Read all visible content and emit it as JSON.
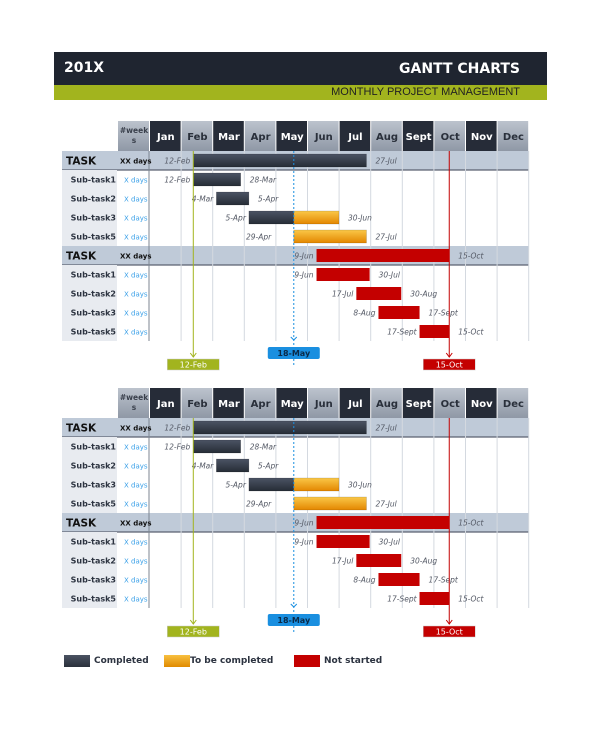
{
  "header": {
    "year": "201X",
    "title": "GANTT CHARTS",
    "subtitle": "MONTHLY PROJECT MANAGEMENT"
  },
  "colors": {
    "banner": "#1f2530",
    "accent_green": "#a2b41e",
    "completed": "#353c4a",
    "to_be_completed": "#f0a010",
    "not_started": "#c40000",
    "today_marker": "#1a8fe0",
    "task_row": "#bfcad8",
    "month_dark": "#262c38",
    "month_light": "#a9b1bd"
  },
  "legend": [
    {
      "label": "Completed",
      "status": "completed"
    },
    {
      "label": "To be completed",
      "status": "to_be_completed"
    },
    {
      "label": "Not started",
      "status": "not_started"
    }
  ],
  "chart_data": [
    {
      "type": "gantt",
      "weeks_header": "#week s",
      "months": [
        "Jan",
        "Feb",
        "Mar",
        "Apr",
        "May",
        "Jun",
        "Jul",
        "Aug",
        "Sept",
        "Oct",
        "Nov",
        "Dec"
      ],
      "markers": [
        {
          "label": "12-Feb",
          "date": 1.37,
          "kind": "start",
          "color": "#a2b41e"
        },
        {
          "label": "18-May",
          "date": 4.55,
          "kind": "today",
          "color": "#1a8fe0"
        },
        {
          "label": "15-Oct",
          "date": 9.47,
          "kind": "end",
          "color": "#c40000"
        }
      ],
      "groups": [
        {
          "task": {
            "name": "TASK",
            "duration": "XX days",
            "start_label": "12-Feb",
            "end_label": "27-Jul",
            "start": 1.37,
            "end": 6.85,
            "segments": [
              {
                "from": 1.37,
                "to": 6.85,
                "status": "completed"
              }
            ]
          },
          "subtasks": [
            {
              "name": "Sub-task1",
              "duration": "X days",
              "start_label": "12-Feb",
              "end_label": "28-Mar",
              "start": 1.37,
              "end": 2.87,
              "segments": [
                {
                  "from": 1.37,
                  "to": 2.87,
                  "status": "completed"
                }
              ]
            },
            {
              "name": "Sub-task2",
              "duration": "X days",
              "start_label": "4-Mar",
              "end_label": "5-Apr",
              "start": 2.1,
              "end": 3.13,
              "segments": [
                {
                  "from": 2.1,
                  "to": 3.13,
                  "status": "completed"
                }
              ]
            },
            {
              "name": "Sub-task3",
              "duration": "X days",
              "start_label": "5-Apr",
              "end_label": "30-Jun",
              "start": 3.13,
              "end": 5.98,
              "segments": [
                {
                  "from": 3.13,
                  "to": 4.55,
                  "status": "completed"
                },
                {
                  "from": 4.55,
                  "to": 5.98,
                  "status": "to_be_completed"
                }
              ]
            },
            {
              "name": "Sub-task5",
              "duration": "X days",
              "start_label": "29-Apr",
              "end_label": "27-Jul",
              "start": 3.93,
              "end": 6.85,
              "segments": [
                {
                  "from": 4.55,
                  "to": 6.85,
                  "status": "to_be_completed"
                }
              ]
            }
          ]
        },
        {
          "task": {
            "name": "TASK",
            "duration": "XX days",
            "start_label": "9-Jun",
            "end_label": "15-Oct",
            "start": 5.27,
            "end": 9.47,
            "segments": [
              {
                "from": 5.27,
                "to": 9.47,
                "status": "not_started"
              }
            ]
          },
          "subtasks": [
            {
              "name": "Sub-task1",
              "duration": "X days",
              "start_label": "9-Jun",
              "end_label": "30-Jul",
              "start": 5.27,
              "end": 6.95,
              "segments": [
                {
                  "from": 5.27,
                  "to": 6.95,
                  "status": "not_started"
                }
              ]
            },
            {
              "name": "Sub-task2",
              "duration": "X days",
              "start_label": "17-Jul",
              "end_label": "30-Aug",
              "start": 6.53,
              "end": 7.95,
              "segments": [
                {
                  "from": 6.53,
                  "to": 7.95,
                  "status": "not_started"
                }
              ]
            },
            {
              "name": "Sub-task3",
              "duration": "X days",
              "start_label": "8-Aug",
              "end_label": "17-Sept",
              "start": 7.23,
              "end": 8.53,
              "segments": [
                {
                  "from": 7.23,
                  "to": 8.53,
                  "status": "not_started"
                }
              ]
            },
            {
              "name": "Sub-task5",
              "duration": "X days",
              "start_label": "17-Sept",
              "end_label": "15-Oct",
              "start": 8.53,
              "end": 9.47,
              "segments": [
                {
                  "from": 8.53,
                  "to": 9.47,
                  "status": "not_started"
                }
              ]
            }
          ]
        }
      ]
    },
    {
      "type": "gantt",
      "weeks_header": "#week s",
      "months": [
        "Jan",
        "Feb",
        "Mar",
        "Apr",
        "May",
        "Jun",
        "Jul",
        "Aug",
        "Sept",
        "Oct",
        "Nov",
        "Dec"
      ],
      "markers": [
        {
          "label": "12-Feb",
          "date": 1.37,
          "kind": "start",
          "color": "#a2b41e"
        },
        {
          "label": "18-May",
          "date": 4.55,
          "kind": "today",
          "color": "#1a8fe0"
        },
        {
          "label": "15-Oct",
          "date": 9.47,
          "kind": "end",
          "color": "#c40000"
        }
      ],
      "groups": [
        {
          "task": {
            "name": "TASK",
            "duration": "XX days",
            "start_label": "12-Feb",
            "end_label": "27-Jul",
            "start": 1.37,
            "end": 6.85,
            "segments": [
              {
                "from": 1.37,
                "to": 6.85,
                "status": "completed"
              }
            ]
          },
          "subtasks": [
            {
              "name": "Sub-task1",
              "duration": "X days",
              "start_label": "12-Feb",
              "end_label": "28-Mar",
              "start": 1.37,
              "end": 2.87,
              "segments": [
                {
                  "from": 1.37,
                  "to": 2.87,
                  "status": "completed"
                }
              ]
            },
            {
              "name": "Sub-task2",
              "duration": "X days",
              "start_label": "4-Mar",
              "end_label": "5-Apr",
              "start": 2.1,
              "end": 3.13,
              "segments": [
                {
                  "from": 2.1,
                  "to": 3.13,
                  "status": "completed"
                }
              ]
            },
            {
              "name": "Sub-task3",
              "duration": "X days",
              "start_label": "5-Apr",
              "end_label": "30-Jun",
              "start": 3.13,
              "end": 5.98,
              "segments": [
                {
                  "from": 3.13,
                  "to": 4.55,
                  "status": "completed"
                },
                {
                  "from": 4.55,
                  "to": 5.98,
                  "status": "to_be_completed"
                }
              ]
            },
            {
              "name": "Sub-task5",
              "duration": "X days",
              "start_label": "29-Apr",
              "end_label": "27-Jul",
              "start": 3.93,
              "end": 6.85,
              "segments": [
                {
                  "from": 4.55,
                  "to": 6.85,
                  "status": "to_be_completed"
                }
              ]
            }
          ]
        },
        {
          "task": {
            "name": "TASK",
            "duration": "XX days",
            "start_label": "9-Jun",
            "end_label": "15-Oct",
            "start": 5.27,
            "end": 9.47,
            "segments": [
              {
                "from": 5.27,
                "to": 9.47,
                "status": "not_started"
              }
            ]
          },
          "subtasks": [
            {
              "name": "Sub-task1",
              "duration": "X days",
              "start_label": "9-Jun",
              "end_label": "30-Jul",
              "start": 5.27,
              "end": 6.95,
              "segments": [
                {
                  "from": 5.27,
                  "to": 6.95,
                  "status": "not_started"
                }
              ]
            },
            {
              "name": "Sub-task2",
              "duration": "X days",
              "start_label": "17-Jul",
              "end_label": "30-Aug",
              "start": 6.53,
              "end": 7.95,
              "segments": [
                {
                  "from": 6.53,
                  "to": 7.95,
                  "status": "not_started"
                }
              ]
            },
            {
              "name": "Sub-task3",
              "duration": "X days",
              "start_label": "8-Aug",
              "end_label": "17-Sept",
              "start": 7.23,
              "end": 8.53,
              "segments": [
                {
                  "from": 7.23,
                  "to": 8.53,
                  "status": "not_started"
                }
              ]
            },
            {
              "name": "Sub-task5",
              "duration": "X days",
              "start_label": "17-Sept",
              "end_label": "15-Oct",
              "start": 8.53,
              "end": 9.47,
              "segments": [
                {
                  "from": 8.53,
                  "to": 9.47,
                  "status": "not_started"
                }
              ]
            }
          ]
        }
      ]
    }
  ]
}
